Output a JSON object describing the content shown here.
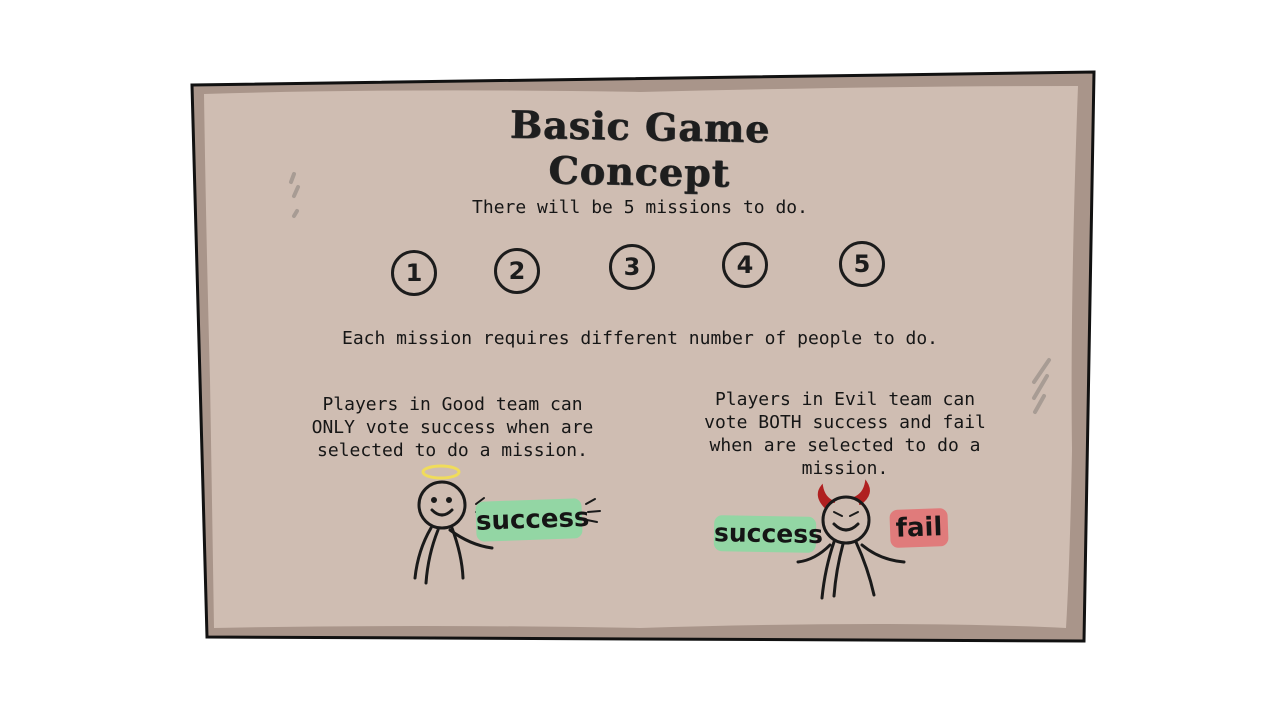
{
  "slide": {
    "title": "Basic Game Concept",
    "intro": "There will be 5 missions to do.",
    "missions": [
      "1",
      "2",
      "3",
      "4",
      "5"
    ],
    "people_note": "Each mission requires different number of people to do.",
    "good_team": {
      "text": "Players in Good team can ONLY vote success when are selected to do a mission.",
      "vote_label": "success"
    },
    "evil_team": {
      "text": "Players in Evil team can vote BOTH success and fail when are selected to do a mission.",
      "success_label": "success",
      "fail_label": "fail"
    }
  },
  "colors": {
    "board": "#cfbdb2",
    "board_edge": "#a9958a",
    "outline": "#111111",
    "success_tag": "#93d6a4",
    "fail_tag": "#e07b7b",
    "halo": "#f0dc5a",
    "horns": "#b02020"
  }
}
